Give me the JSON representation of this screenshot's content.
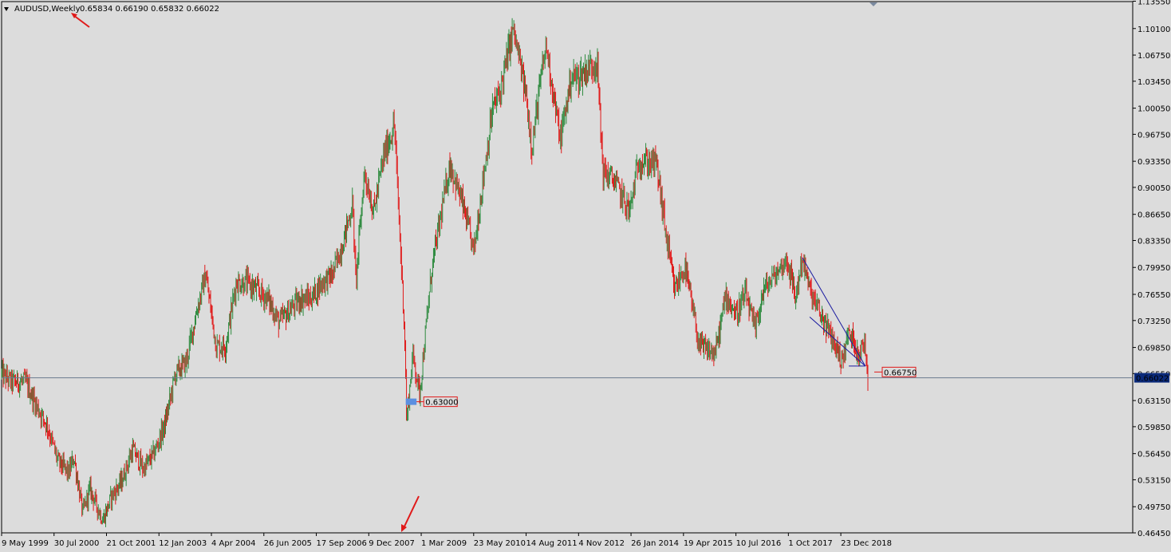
{
  "header": {
    "symbol": "AUDUSD,Weekly",
    "ohlc": "0.65834 0.66190 0.65832 0.66022"
  },
  "colors": {
    "background": "#dcdcdc",
    "bull": "#2e8b3f",
    "bear": "#e01a1a",
    "current_price_box": "#0b2a7a",
    "label_border": "#e01a1a",
    "trendline": "#1a1aa0",
    "zone": "#5b8fe0",
    "arrow": "#e01a1a"
  },
  "chart_data": {
    "type": "candlestick",
    "title": "AUDUSD,Weekly",
    "ylim": [
      0.4645,
      1.135
    ],
    "y_ticks": [
      "1.13550",
      "1.10100",
      "1.06750",
      "1.03450",
      "1.00050",
      "0.96750",
      "0.93350",
      "0.90050",
      "0.86650",
      "0.83350",
      "0.79950",
      "0.76550",
      "0.73250",
      "0.69850",
      "0.66550",
      "0.63150",
      "0.59850",
      "0.56450",
      "0.53150",
      "0.49750",
      "0.46450"
    ],
    "x_ticks": [
      "9 May 1999",
      "30 Jul 2000",
      "21 Oct 2001",
      "12 Jan 2003",
      "4 Apr 2004",
      "26 Jun 2005",
      "17 Sep 2006",
      "9 Dec 2007",
      "1 Mar 2009",
      "23 May 2010",
      "14 Aug 2011",
      "4 Nov 2012",
      "26 Jan 2014",
      "19 Apr 2015",
      "10 Jul 2016",
      "1 Oct 2017",
      "23 Dec 2018"
    ],
    "x_range": [
      "1999-05-09",
      "2019-08-11"
    ],
    "current_price": "0.66022",
    "price_path": [
      [
        "1999-05-09",
        0.665
      ],
      [
        "1999-08-01",
        0.655
      ],
      [
        "1999-12-01",
        0.655
      ],
      [
        "2000-03-01",
        0.625
      ],
      [
        "2000-06-01",
        0.6
      ],
      [
        "2000-09-01",
        0.555
      ],
      [
        "2000-12-01",
        0.54
      ],
      [
        "2001-01-15",
        0.56
      ],
      [
        "2001-04-01",
        0.49
      ],
      [
        "2001-06-01",
        0.52
      ],
      [
        "2001-09-20",
        0.48
      ],
      [
        "2001-12-01",
        0.51
      ],
      [
        "2002-03-01",
        0.53
      ],
      [
        "2002-06-01",
        0.57
      ],
      [
        "2002-09-01",
        0.545
      ],
      [
        "2002-12-01",
        0.565
      ],
      [
        "2003-03-01",
        0.6
      ],
      [
        "2003-06-01",
        0.665
      ],
      [
        "2003-09-01",
        0.68
      ],
      [
        "2003-12-01",
        0.745
      ],
      [
        "2004-02-15",
        0.79
      ],
      [
        "2004-05-15",
        0.7
      ],
      [
        "2004-08-01",
        0.7
      ],
      [
        "2004-11-01",
        0.78
      ],
      [
        "2005-02-01",
        0.78
      ],
      [
        "2005-05-01",
        0.77
      ],
      [
        "2005-08-01",
        0.76
      ],
      [
        "2005-11-01",
        0.73
      ],
      [
        "2006-02-01",
        0.745
      ],
      [
        "2006-05-01",
        0.76
      ],
      [
        "2006-08-01",
        0.76
      ],
      [
        "2006-11-01",
        0.78
      ],
      [
        "2007-02-01",
        0.79
      ],
      [
        "2007-05-01",
        0.83
      ],
      [
        "2007-07-25",
        0.88
      ],
      [
        "2007-08-20",
        0.78
      ],
      [
        "2007-11-01",
        0.92
      ],
      [
        "2008-01-20",
        0.87
      ],
      [
        "2008-04-15",
        0.94
      ],
      [
        "2008-07-15",
        0.98
      ],
      [
        "2008-08-20",
        0.87
      ],
      [
        "2008-10-10",
        0.72
      ],
      [
        "2008-10-27",
        0.605
      ],
      [
        "2008-12-20",
        0.69
      ],
      [
        "2009-02-15",
        0.64
      ],
      [
        "2009-06-01",
        0.8
      ],
      [
        "2009-11-01",
        0.93
      ],
      [
        "2010-02-15",
        0.88
      ],
      [
        "2010-05-25",
        0.82
      ],
      [
        "2010-08-01",
        0.9
      ],
      [
        "2010-11-01",
        1.0
      ],
      [
        "2011-01-01",
        1.02
      ],
      [
        "2011-04-25",
        1.1
      ],
      [
        "2011-08-10",
        1.02
      ],
      [
        "2011-10-04",
        0.95
      ],
      [
        "2011-12-01",
        1.02
      ],
      [
        "2012-02-01",
        1.08
      ],
      [
        "2012-06-01",
        0.96
      ],
      [
        "2012-09-01",
        1.04
      ],
      [
        "2012-11-01",
        1.04
      ],
      [
        "2013-04-10",
        1.06
      ],
      [
        "2013-06-01",
        0.92
      ],
      [
        "2013-09-01",
        0.91
      ],
      [
        "2014-01-15",
        0.87
      ],
      [
        "2014-04-01",
        0.935
      ],
      [
        "2014-09-01",
        0.93
      ],
      [
        "2014-12-01",
        0.83
      ],
      [
        "2015-02-01",
        0.77
      ],
      [
        "2015-05-01",
        0.8
      ],
      [
        "2015-09-01",
        0.7
      ],
      [
        "2016-01-15",
        0.69
      ],
      [
        "2016-04-15",
        0.765
      ],
      [
        "2016-07-10",
        0.74
      ],
      [
        "2016-10-01",
        0.765
      ],
      [
        "2016-12-20",
        0.72
      ],
      [
        "2017-03-01",
        0.77
      ],
      [
        "2017-09-20",
        0.81
      ],
      [
        "2017-12-01",
        0.76
      ],
      [
        "2018-01-28",
        0.812
      ],
      [
        "2018-04-01",
        0.77
      ],
      [
        "2018-07-01",
        0.74
      ],
      [
        "2018-10-25",
        0.705
      ],
      [
        "2019-01-02",
        0.68
      ],
      [
        "2019-02-20",
        0.715
      ],
      [
        "2019-04-01",
        0.71
      ],
      [
        "2019-06-01",
        0.69
      ],
      [
        "2019-07-15",
        0.705
      ],
      [
        "2019-08-11",
        0.6602
      ]
    ],
    "annotations": [
      {
        "type": "price_label",
        "text": "0.63000",
        "date": "2008-11-20",
        "value": 0.63
      },
      {
        "type": "price_label",
        "text": "0.66750",
        "date": "2019-08-11",
        "value": 0.6675
      },
      {
        "type": "zone",
        "date_start": "2008-10-20",
        "date_end": "2009-01-20",
        "value": 0.63
      },
      {
        "type": "trendline",
        "from": [
          "2018-01-28",
          0.812
        ],
        "to": [
          "2019-07-20",
          0.675
        ]
      },
      {
        "type": "trendline",
        "from": [
          "2018-04-01",
          0.737
        ],
        "to": [
          "2019-07-20",
          0.675
        ]
      },
      {
        "type": "trendline",
        "from": [
          "2019-03-01",
          0.675
        ],
        "to": [
          "2019-07-20",
          0.675
        ]
      }
    ]
  }
}
